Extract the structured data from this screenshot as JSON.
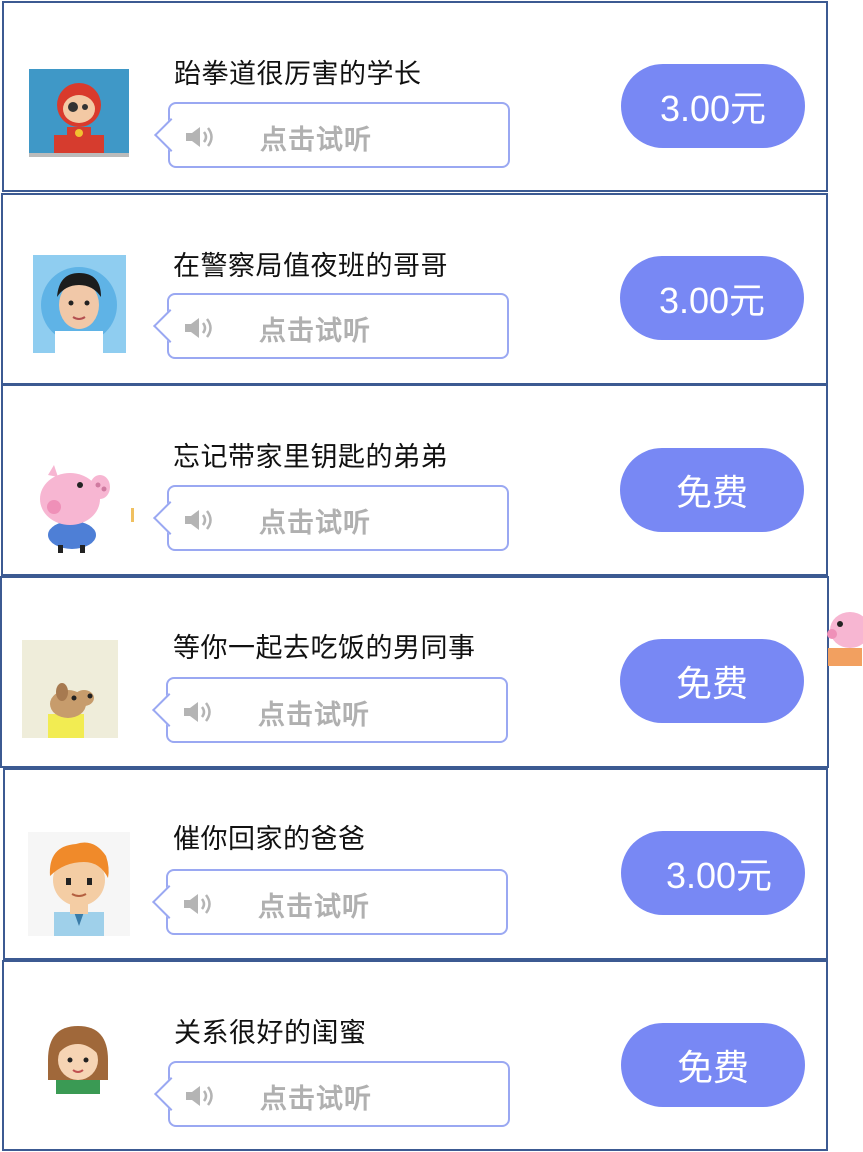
{
  "voices": [
    {
      "name": "跆拳道很厉害的学长",
      "listen_label": "点击试听",
      "price": "3.00元",
      "avatar_icon": "taekwondo-boy-avatar-icon"
    },
    {
      "name": "在警察局值夜班的哥哥",
      "listen_label": "点击试听",
      "price": "3.00元",
      "avatar_icon": "police-brother-avatar-icon"
    },
    {
      "name": "忘记带家里钥匙的弟弟",
      "listen_label": "点击试听",
      "price": "免费",
      "avatar_icon": "pink-pig-avatar-icon"
    },
    {
      "name": "等你一起去吃饭的男同事",
      "listen_label": "点击试听",
      "price": "免费",
      "avatar_icon": "cartoon-dog-avatar-icon"
    },
    {
      "name": "催你回家的爸爸",
      "listen_label": "点击试听",
      "price": "3.00元",
      "avatar_icon": "orange-hair-dad-avatar-icon"
    },
    {
      "name": "关系很好的闺蜜",
      "listen_label": "点击试听",
      "price": "免费",
      "avatar_icon": "girl-bestie-avatar-icon"
    }
  ],
  "colors": {
    "price_button": "#7888f4",
    "card_border": "#3c5a92",
    "bubble_border": "#9aa8f2",
    "listen_text": "#b0b0b0"
  }
}
